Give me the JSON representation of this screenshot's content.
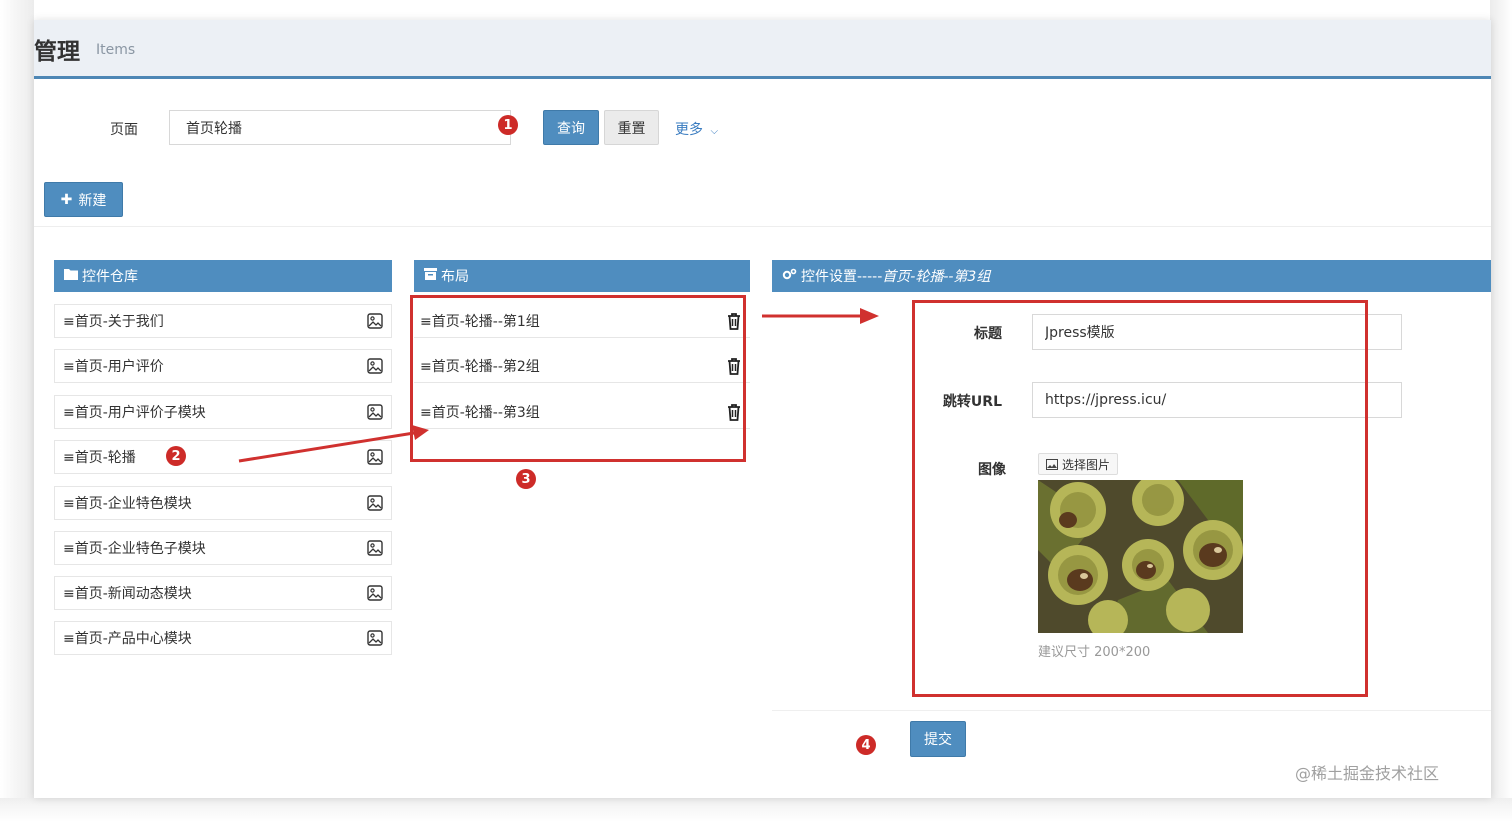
{
  "header": {
    "title": "管理",
    "subtitle": "Items"
  },
  "filter": {
    "label": "页面",
    "value": "首页轮播",
    "query_label": "查询",
    "reset_label": "重置",
    "more_label": "更多"
  },
  "toolbar": {
    "new_label": "新建"
  },
  "library": {
    "heading": "控件仓库",
    "items": [
      "≡首页-关于我们",
      "≡首页-用户评价",
      "≡首页-用户评价子模块",
      "≡首页-轮播",
      "≡首页-企业特色模块",
      "≡首页-企业特色子模块",
      "≡首页-新闻动态模块",
      "≡首页-产品中心模块"
    ]
  },
  "layout": {
    "heading": "布局",
    "items": [
      "≡首页-轮播--第1组",
      "≡首页-轮播--第2组",
      "≡首页-轮播--第3组"
    ]
  },
  "settings": {
    "heading_prefix": "控件设置-----",
    "heading_target": "首页-轮播--第3组",
    "title_label": "标题",
    "title_value": "Jpress模版",
    "url_label": "跳转URL",
    "url_value": "https://jpress.icu/",
    "image_label": "图像",
    "pick_image_label": "选择图片",
    "size_hint": "建议尺寸 200*200",
    "submit_label": "提交"
  },
  "annotations": {
    "b1": "1",
    "b2": "2",
    "b3": "3",
    "b4": "4"
  },
  "watermark": "@稀土掘金技术社区",
  "colors": {
    "primary": "#4f8dbf",
    "header_bg": "#ecf0f5",
    "annotation_red": "#d0312f"
  }
}
